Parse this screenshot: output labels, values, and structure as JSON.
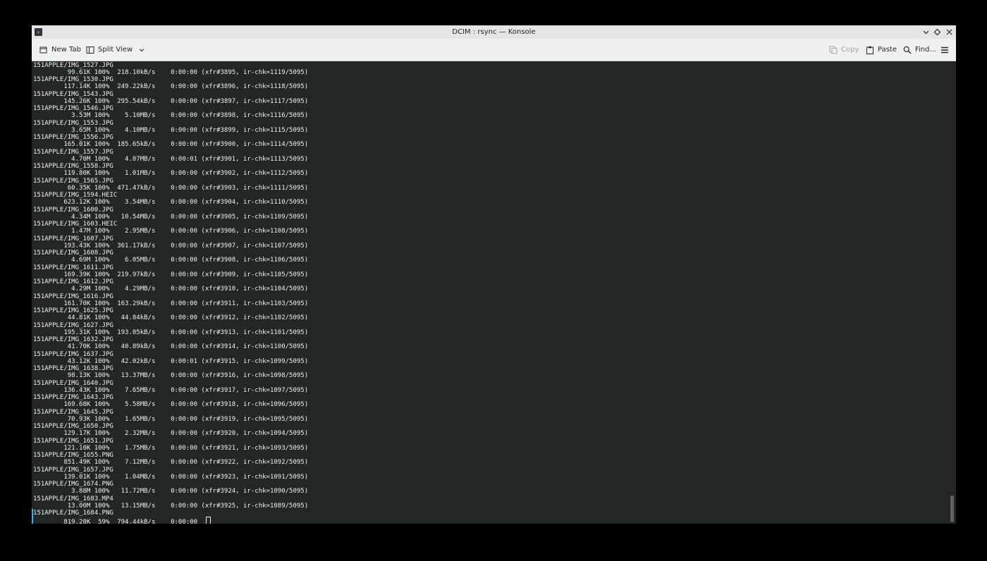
{
  "window": {
    "title": "DCIM : rsync — Konsole"
  },
  "toolbar": {
    "new_tab": "New Tab",
    "split_view": "Split View",
    "copy": "Copy",
    "paste": "Paste",
    "find": "Find..."
  },
  "colors": {
    "terminal_bg": "#232627",
    "terminal_fg": "#eff0f1",
    "toolbar_bg": "#eff0f1",
    "accent": "#3daee9"
  },
  "icons": {
    "app": "terminal-icon",
    "minimize": "chevron-down-icon",
    "maximize": "diamond-icon",
    "close": "close-icon",
    "new_tab": "new-tab-icon",
    "split_view": "split-view-icon",
    "copy": "copy-icon",
    "paste": "paste-icon",
    "find": "search-icon",
    "menu": "hamburger-menu-icon"
  },
  "terminal": {
    "lines": [
      "151APPLE/IMG_1527.JPG",
      "         99.61K 100%  218.10kB/s    0:00:00 (xfr#3895, ir-chk=1119/5095)",
      "151APPLE/IMG_1530.JPG",
      "        117.14K 100%  249.22kB/s    0:00:00 (xfr#3896, ir-chk=1118/5095)",
      "151APPLE/IMG_1543.JPG",
      "        145.26K 100%  295.54kB/s    0:00:00 (xfr#3897, ir-chk=1117/5095)",
      "151APPLE/IMG_1546.JPG",
      "          3.53M 100%    5.10MB/s    0:00:00 (xfr#3898, ir-chk=1116/5095)",
      "151APPLE/IMG_1553.JPG",
      "          3.65M 100%    4.10MB/s    0:00:00 (xfr#3899, ir-chk=1115/5095)",
      "151APPLE/IMG_1556.JPG",
      "        165.01K 100%  185.65kB/s    0:00:00 (xfr#3900, ir-chk=1114/5095)",
      "151APPLE/IMG_1557.JPG",
      "          4.70M 100%    4.07MB/s    0:00:01 (xfr#3901, ir-chk=1113/5095)",
      "151APPLE/IMG_1558.JPG",
      "        119.80K 100%    1.01MB/s    0:00:00 (xfr#3902, ir-chk=1112/5095)",
      "151APPLE/IMG_1565.JPG",
      "         60.35K 100%  471.47kB/s    0:00:00 (xfr#3903, ir-chk=1111/5095)",
      "151APPLE/IMG_1594.HEIC",
      "        623.12K 100%    3.54MB/s    0:00:00 (xfr#3904, ir-chk=1110/5095)",
      "151APPLE/IMG_1600.JPG",
      "          4.34M 100%   10.54MB/s    0:00:00 (xfr#3905, ir-chk=1109/5095)",
      "151APPLE/IMG_1603.HEIC",
      "          1.47M 100%    2.95MB/s    0:00:00 (xfr#3906, ir-chk=1108/5095)",
      "151APPLE/IMG_1607.JPG",
      "        193.43K 100%  361.17kB/s    0:00:00 (xfr#3907, ir-chk=1107/5095)",
      "151APPLE/IMG_1608.JPG",
      "          4.69M 100%    6.05MB/s    0:00:00 (xfr#3908, ir-chk=1106/5095)",
      "151APPLE/IMG_1611.JPG",
      "        169.39K 100%  219.97kB/s    0:00:00 (xfr#3909, ir-chk=1105/5095)",
      "151APPLE/IMG_1612.JPG",
      "          4.29M 100%    4.29MB/s    0:00:00 (xfr#3910, ir-chk=1104/5095)",
      "151APPLE/IMG_1616.JPG",
      "        161.70K 100%  163.29kB/s    0:00:00 (xfr#3911, ir-chk=1103/5095)",
      "151APPLE/IMG_1625.JPG",
      "         44.81K 100%   44.84kB/s    0:00:00 (xfr#3912, ir-chk=1102/5095)",
      "151APPLE/IMG_1627.JPG",
      "        195.31K 100%  193.05kB/s    0:00:00 (xfr#3913, ir-chk=1101/5095)",
      "151APPLE/IMG_1632.JPG",
      "         41.70K 100%   40.89kB/s    0:00:00 (xfr#3914, ir-chk=1100/5095)",
      "151APPLE/IMG_1637.JPG",
      "         43.12K 100%   42.02kB/s    0:00:01 (xfr#3915, ir-chk=1099/5095)",
      "151APPLE/IMG_1638.JPG",
      "         98.13K 100%   13.37MB/s    0:00:00 (xfr#3916, ir-chk=1098/5095)",
      "151APPLE/IMG_1640.JPG",
      "        136.43K 100%    7.65MB/s    0:00:00 (xfr#3917, ir-chk=1097/5095)",
      "151APPLE/IMG_1643.JPG",
      "        169.68K 100%    5.58MB/s    0:00:00 (xfr#3918, ir-chk=1096/5095)",
      "151APPLE/IMG_1645.JPG",
      "         70.93K 100%    1.65MB/s    0:00:00 (xfr#3919, ir-chk=1095/5095)",
      "151APPLE/IMG_1650.JPG",
      "        129.17K 100%    2.32MB/s    0:00:00 (xfr#3920, ir-chk=1094/5095)",
      "151APPLE/IMG_1651.JPG",
      "        121.10K 100%    1.75MB/s    0:00:00 (xfr#3921, ir-chk=1093/5095)",
      "151APPLE/IMG_1655.PNG",
      "        851.49K 100%    7.12MB/s    0:00:00 (xfr#3922, ir-chk=1092/5095)",
      "151APPLE/IMG_1657.JPG",
      "        139.01K 100%    1.04MB/s    0:00:00 (xfr#3923, ir-chk=1091/5095)",
      "151APPLE/IMG_1674.PNG",
      "          3.88M 100%   11.72MB/s    0:00:00 (xfr#3924, ir-chk=1090/5095)",
      "151APPLE/IMG_1683.MP4",
      "         13.00M 100%   13.15MB/s    0:00:00 (xfr#3925, ir-chk=1089/5095)",
      "151APPLE/IMG_1684.PNG",
      "        819.20K  59%  794.44kB/s    0:00:00  "
    ]
  }
}
